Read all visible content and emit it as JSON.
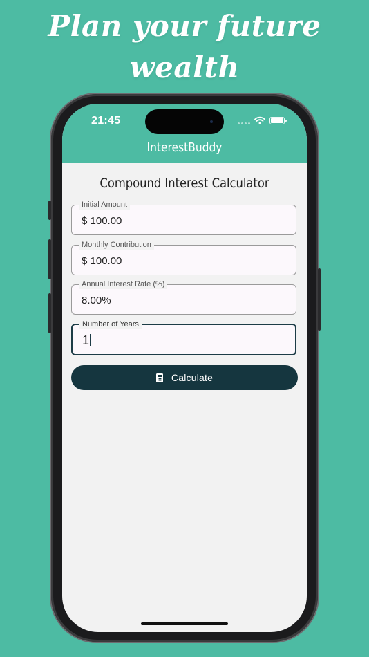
{
  "headline": {
    "line1": "Plan your future",
    "line2": "wealth"
  },
  "status_bar": {
    "time": "21:45"
  },
  "app": {
    "title": "InterestBuddy"
  },
  "page": {
    "title": "Compound Interest Calculator"
  },
  "fields": [
    {
      "label": "Initial Amount",
      "value": "$ 100.00"
    },
    {
      "label": "Monthly Contribution",
      "value": "$ 100.00"
    },
    {
      "label": "Annual Interest Rate (%)",
      "value": "8.00%"
    },
    {
      "label": "Number of Years",
      "value": "1"
    }
  ],
  "calculate_button": {
    "label": "Calculate",
    "icon": "calculator-icon"
  },
  "colors": {
    "background": "#4dbba3",
    "button": "#15363f",
    "screen": "#f2f2f2"
  }
}
